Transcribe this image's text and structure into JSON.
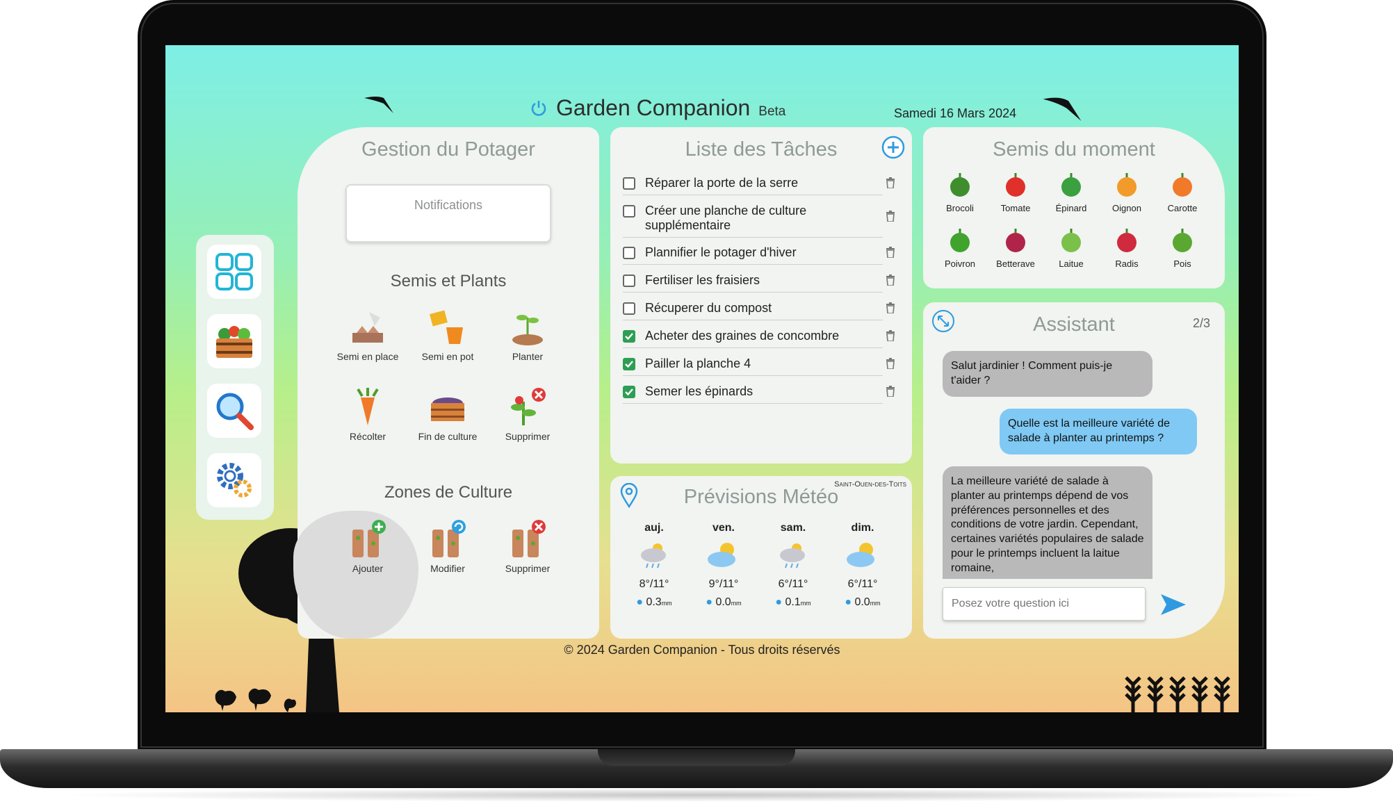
{
  "app": {
    "title": "Garden Companion",
    "badge": "Beta",
    "date": "Samedi 16 Mars 2024"
  },
  "nav": [
    {
      "name": "dashboard",
      "icon": "grid-icon"
    },
    {
      "name": "harvest-crate",
      "icon": "vegetable-crate-icon"
    },
    {
      "name": "search",
      "icon": "magnifier-icon"
    },
    {
      "name": "settings",
      "icon": "gears-icon"
    }
  ],
  "potager": {
    "title": "Gestion du Potager",
    "notifications_placeholder": "Notifications",
    "semis_title": "Semis et Plants",
    "semis_items": [
      "Semi en place",
      "Semi en pot",
      "Planter",
      "Récolter",
      "Fin de culture",
      "Supprimer"
    ],
    "zones_title": "Zones de Culture",
    "zones_items": [
      "Ajouter",
      "Modifier",
      "Supprimer"
    ]
  },
  "tasks": {
    "title": "Liste des Tâches",
    "items": [
      {
        "label": "Réparer la porte de la serre",
        "done": false
      },
      {
        "label": "Créer une planche de culture supplémentaire",
        "done": false
      },
      {
        "label": "Plannifier le potager d'hiver",
        "done": false
      },
      {
        "label": "Fertiliser les fraisiers",
        "done": false
      },
      {
        "label": "Récuperer du compost",
        "done": false
      },
      {
        "label": "Acheter des graines de concombre",
        "done": true
      },
      {
        "label": "Pailler la planche 4",
        "done": true
      },
      {
        "label": "Semer les épinards",
        "done": true
      }
    ]
  },
  "weather": {
    "title": "Prévisions Météo",
    "location": "Saint-Ouen-des-Toits",
    "days": [
      {
        "day": "auj.",
        "temp": "8°/11°",
        "rain": "0.3",
        "unit": "mm",
        "icon": "rain-cloud-icon"
      },
      {
        "day": "ven.",
        "temp": "9°/11°",
        "rain": "0.0",
        "unit": "mm",
        "icon": "partly-sunny-icon"
      },
      {
        "day": "sam.",
        "temp": "6°/11°",
        "rain": "0.1",
        "unit": "mm",
        "icon": "rain-cloud-icon"
      },
      {
        "day": "dim.",
        "temp": "6°/11°",
        "rain": "0.0",
        "unit": "mm",
        "icon": "partly-sunny-icon"
      }
    ]
  },
  "semis_moment": {
    "title": "Semis du moment",
    "items": [
      "Brocoli",
      "Tomate",
      "Épinard",
      "Oignon",
      "Carotte",
      "Poivron",
      "Betterave",
      "Laitue",
      "Radis",
      "Pois"
    ]
  },
  "assistant": {
    "title": "Assistant",
    "page": "2/3",
    "messages": [
      {
        "from": "bot",
        "text": "Salut jardinier ! Comment puis-je t'aider ?"
      },
      {
        "from": "user",
        "text": "Quelle est la meilleure variété de salade à planter au printemps ?"
      },
      {
        "from": "bot",
        "text": "La meilleure variété de salade à planter au printemps dépend de vos préférences personnelles et des conditions de votre jardin. Cependant, certaines variétés populaires de salade pour le printemps incluent la laitue romaine,"
      }
    ],
    "input_placeholder": "Posez votre question ici"
  },
  "footer": "© 2024 Garden Companion - Tous droits réservés",
  "colors": {
    "accent": "#2f9ae0",
    "check": "#2e9e55",
    "bot_bubble": "#b9b9b9",
    "user_bubble": "#7fc9f4"
  }
}
